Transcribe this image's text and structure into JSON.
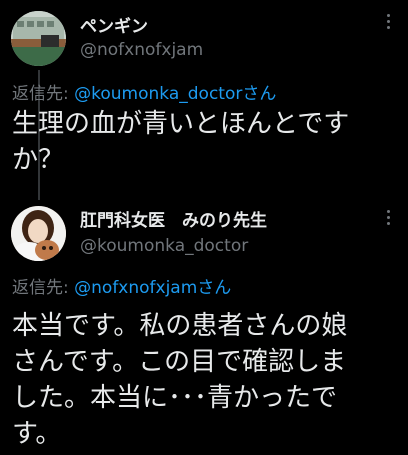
{
  "tweets": [
    {
      "display_name": "ペンギン",
      "handle": "@nofxnofxjam",
      "reply_prefix": "返信先:",
      "reply_to": "@koumonka_doctorさん",
      "text_lines": [
        "生理の血が青いとほんとです",
        "か？"
      ]
    },
    {
      "display_name": "肛門科女医　みのり先生",
      "handle": "@koumonka_doctor",
      "reply_prefix": "返信先:",
      "reply_to": "@nofxnofxjamさん",
      "text_lines": [
        "本当です。私の患者さんの娘",
        "さんです。この目で確認しま",
        "した。本当に･･･青かったで",
        "す。"
      ]
    }
  ],
  "colors": {
    "background": "#000000",
    "text": "#e7e9ea",
    "muted": "#71767b",
    "link": "#1d9bf0"
  }
}
